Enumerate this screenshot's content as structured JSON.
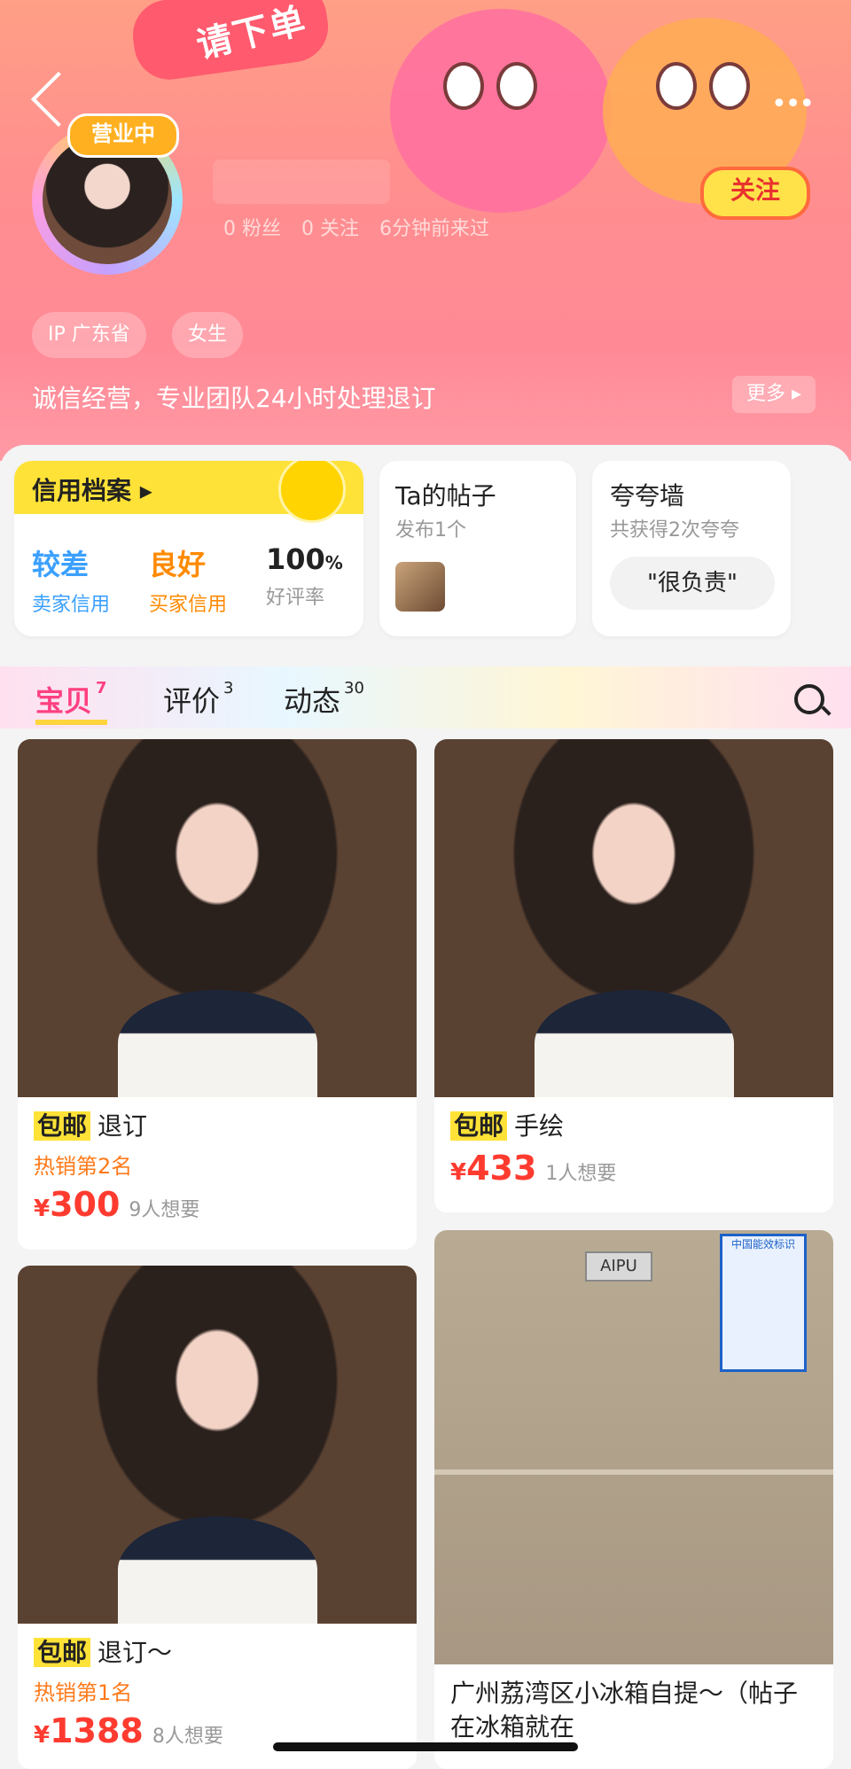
{
  "header": {
    "banner_text": "请下单",
    "open_badge": "营业中",
    "stats": {
      "fans": "0 粉丝",
      "following": "0 关注",
      "last_seen": "6分钟前来过"
    },
    "follow_label": "关注",
    "more_dots": "•••",
    "tags": [
      "IP 广东省",
      "女生"
    ],
    "bio": "诚信经营，专业团队24小时处理退订",
    "more_label": "更多 ▸"
  },
  "cards": {
    "credit": {
      "title": "信用档案 ▸",
      "seller_value": "较差",
      "seller_label": "卖家信用",
      "buyer_value": "良好",
      "buyer_label": "买家信用",
      "rate_value": "100",
      "rate_unit": "%",
      "rate_label": "好评率"
    },
    "posts": {
      "title": "Ta的帖子",
      "sub": "发布1个"
    },
    "praise": {
      "title": "夸夸墙",
      "sub": "共获得2次夸夸",
      "pill": "\"很负责\""
    }
  },
  "tabs": [
    {
      "label": "宝贝",
      "count": "7"
    },
    {
      "label": "评价",
      "count": "3"
    },
    {
      "label": "动态",
      "count": "30"
    }
  ],
  "items": [
    {
      "badge": "包邮",
      "title": "退订",
      "hot": "热销第2名",
      "currency": "¥",
      "price": "300",
      "want": "9人想要"
    },
    {
      "badge": "包邮",
      "title": "手绘",
      "hot": "",
      "currency": "¥",
      "price": "433",
      "want": "1人想要"
    },
    {
      "badge": "包邮",
      "title": "退订～",
      "hot": "热销第1名",
      "currency": "¥",
      "price": "1388",
      "want": "8人想要"
    },
    {
      "title": "广州荔湾区小冰箱自提～（帖子在冰箱就在",
      "fridge_brand": "AIPU",
      "energy_label": "中国能效标识"
    }
  ],
  "colors": {
    "accent_pink": "#ff4080",
    "price_red": "#ff3b30",
    "badge_yellow": "#ffe237",
    "seller_blue": "#3aa0ff",
    "buyer_orange": "#ff8a00"
  }
}
